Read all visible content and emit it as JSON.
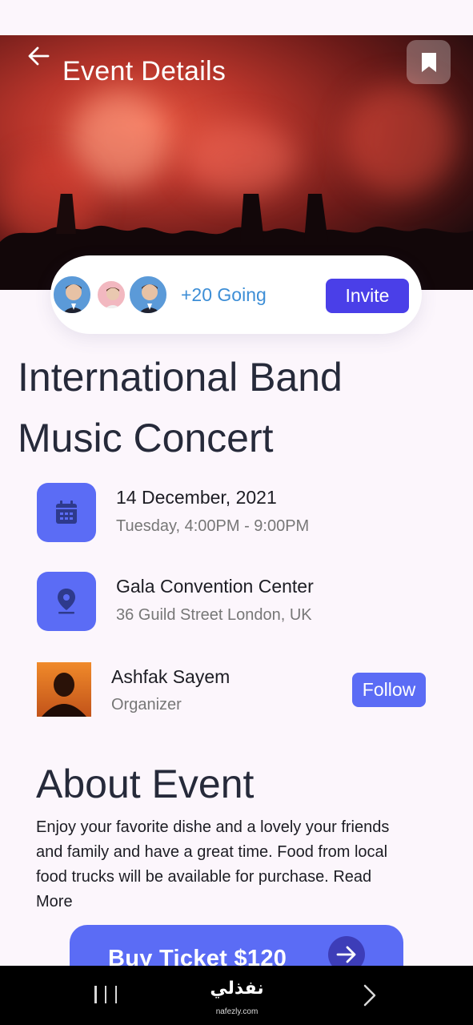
{
  "header": {
    "title": "Event Details",
    "back_icon": "arrow-left-icon",
    "bookmark_icon": "bookmark-icon"
  },
  "attendance": {
    "going_text": "+20 Going",
    "invite_label": "Invite",
    "avatars": [
      "avatar-1",
      "avatar-2",
      "avatar-3"
    ]
  },
  "event": {
    "title": "International Band Music Concert",
    "date": "14 December, 2021",
    "time": "Tuesday, 4:00PM - 9:00PM",
    "venue": "Gala Convention Center",
    "address": "36 Guild Street London, UK"
  },
  "organizer": {
    "name": "Ashfak Sayem",
    "role": "Organizer",
    "follow_label": "Follow"
  },
  "about": {
    "heading": "About Event",
    "body": "Enjoy your favorite dishe and a lovely your friends and family and have a great time. Food from local food trucks will be available for purchase.",
    "read_more": "Read More"
  },
  "cta": {
    "buy_label": "Buy Ticket $120",
    "arrow_icon": "arrow-right-icon"
  },
  "watermark": {
    "main": "نفذلي",
    "sub": "nafezly.com"
  },
  "colors": {
    "accent": "#5b6cf5",
    "invite": "#4a3fe8",
    "going": "#3d8ed6",
    "background": "#fcf6fc"
  }
}
